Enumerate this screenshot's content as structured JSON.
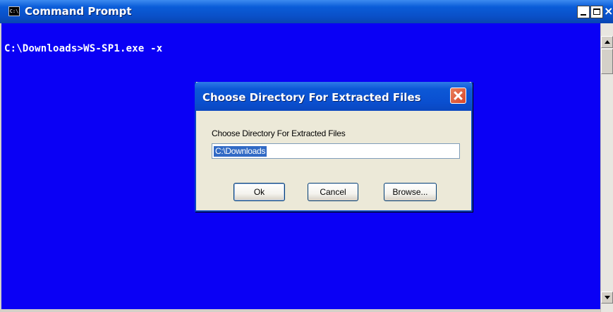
{
  "console_window": {
    "title": "Command Prompt",
    "icon": "cmd-icon",
    "icon_text": "C:\\",
    "close_glyph": "×",
    "prompt_line": "C:\\Downloads>WS-SP1.exe -x",
    "background_color": "#0a00f5",
    "text_color": "#ffffff"
  },
  "dialog": {
    "title": "Choose Directory For Extracted Files",
    "label": "Choose Directory For Extracted Files",
    "directory_value": "C:\\Downloads",
    "ok_label": "Ok",
    "cancel_label": "Cancel",
    "browse_label": "Browse...",
    "title_color": "#0a4fd0",
    "close_color": "#d9462a"
  }
}
